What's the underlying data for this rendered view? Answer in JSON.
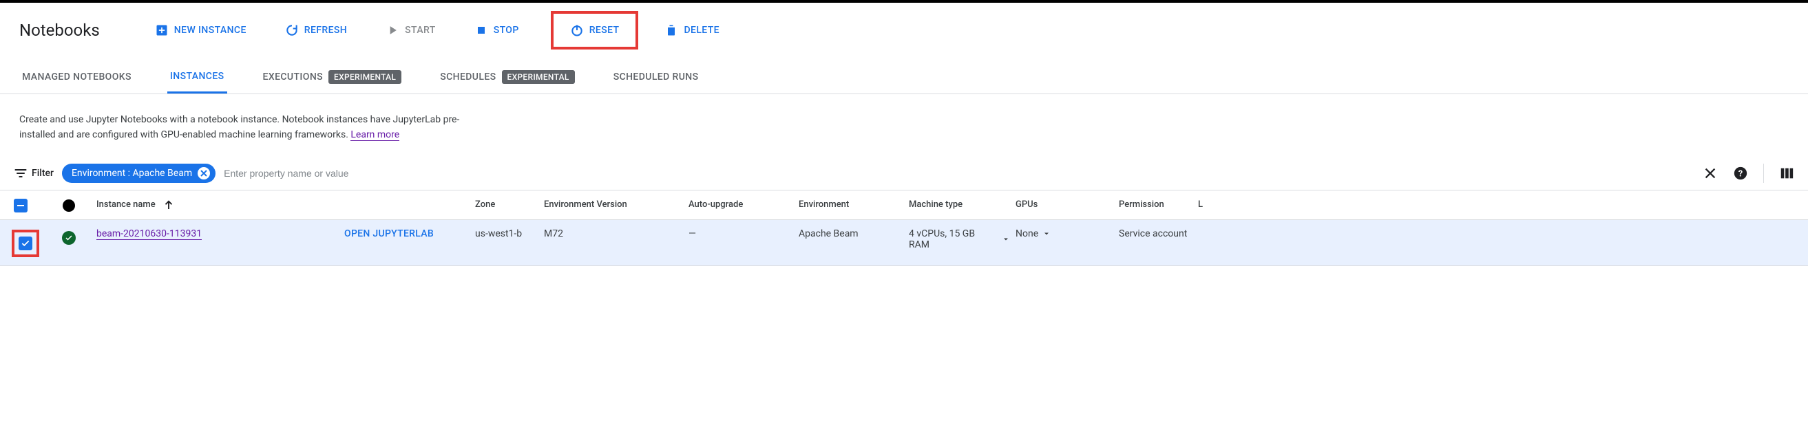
{
  "page": {
    "title": "Notebooks"
  },
  "actions": {
    "new_instance": "NEW INSTANCE",
    "refresh": "REFRESH",
    "start": "START",
    "stop": "STOP",
    "reset": "RESET",
    "delete": "DELETE"
  },
  "tabs": {
    "managed": "MANAGED NOTEBOOKS",
    "instances": "INSTANCES",
    "executions": "EXECUTIONS",
    "schedules": "SCHEDULES",
    "scheduled_runs": "SCHEDULED RUNS",
    "badge_experimental": "EXPERIMENTAL"
  },
  "intro": {
    "text": "Create and use Jupyter Notebooks with a notebook instance. Notebook instances have JupyterLab pre-installed and are configured with GPU-enabled machine learning frameworks. ",
    "learn_more": "Learn more"
  },
  "filter": {
    "label": "Filter",
    "chip": "Environment : Apache Beam",
    "placeholder": "Enter property name or value"
  },
  "columns": {
    "instance_name": "Instance name",
    "zone": "Zone",
    "env_version": "Environment Version",
    "auto_upgrade": "Auto-upgrade",
    "environment": "Environment",
    "machine_type": "Machine type",
    "gpus": "GPUs",
    "permission": "Permission",
    "labels_cutoff": "L"
  },
  "rows": [
    {
      "name": "beam-20210630-113931",
      "open_label": "OPEN JUPYTERLAB",
      "zone": "us-west1-b",
      "env_version": "M72",
      "auto_upgrade": "—",
      "environment": "Apache Beam",
      "machine_type": "4 vCPUs, 15 GB RAM",
      "gpus": "None",
      "permission": "Service account"
    }
  ]
}
